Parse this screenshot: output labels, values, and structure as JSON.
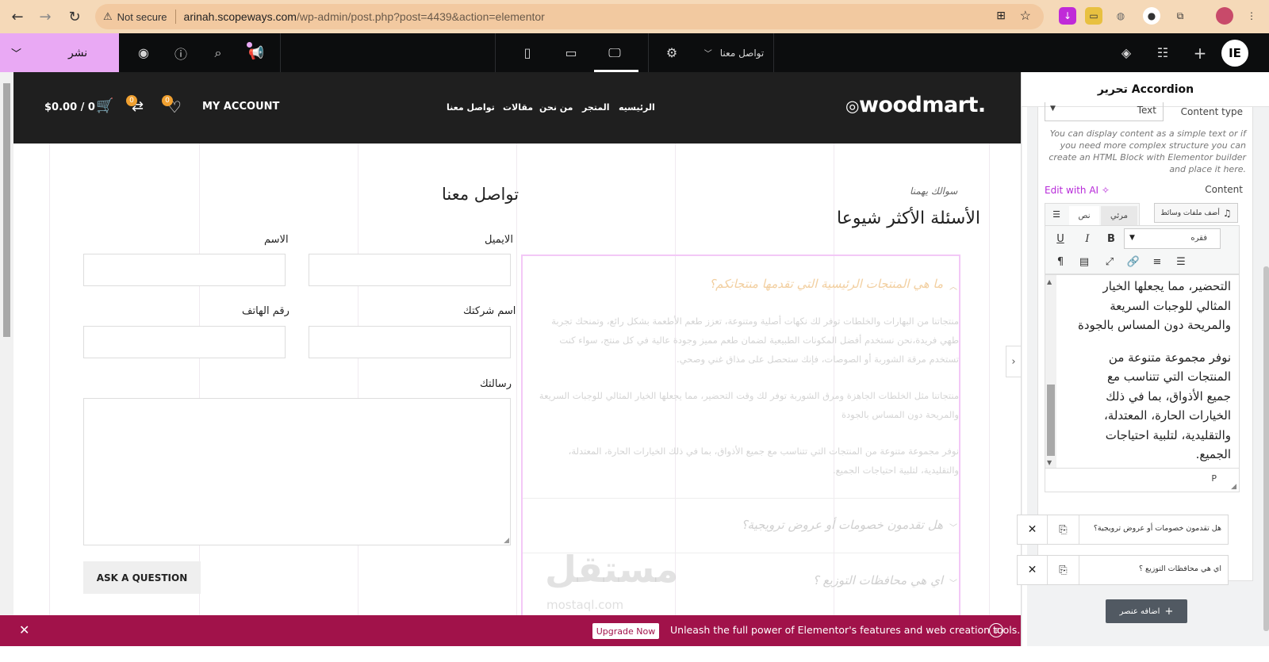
{
  "browser": {
    "not_secure": "Not secure",
    "url_host": "arinah.scopeways.com",
    "url_path": "/wp-admin/post.php?post=4439&action=elementor"
  },
  "topbar": {
    "publish_label": "نشر",
    "page_name": "تواصل معنا"
  },
  "site": {
    "logo": "woodmart.",
    "nav": [
      "الرئيسيه",
      "المتجر",
      "من نحن",
      "مقالات",
      "تواصل معنا"
    ],
    "account": "MY ACCOUNT",
    "wishlist_count": "0",
    "compare_count": "0",
    "cart": "$0.00 / 0"
  },
  "faq": {
    "kicker": "سوالك يهمنا",
    "title": "الأسئلة الأكثر شيوعا",
    "q1": "ما هي المنتجات الرئيسية التي تقدمها منتجاتكم؟",
    "p1": "منتجاتنا من البهارات والخلطات توفر لك نكهات أصلية ومتنوعة، تعزز طعم الأطعمة بشكل رائع، وتمنحك تجربة طهي فريدة،نحن نستخدم أفضل المكونات الطبيعية لضمان طعم مميز وجودة عالية في كل منتج، سواء كنت تستخدم مرقة الشوربة أو الصوصات، فإنك ستحصل على مذاق غني وصحي.",
    "p2": "منتجاتنا مثل الخلطات الجاهزة ومرق الشوربة توفر لك وقت التحضير، مما يجعلها الخيار المثالي للوجبات السريعة والمريحة دون المساس بالجودة",
    "p3": "نوفر مجموعة متنوعة من المنتجات التي تتناسب مع جميع الأذواق، بما في ذلك الخيارات الحارة، المعتدلة، والتقليدية، لتلبية احتياجات الجميع.",
    "q2": "هل تقدمون خصومات أو عروض ترويجية؟",
    "q3": "اي هي محافظات التوزيع ؟"
  },
  "contact": {
    "title": "تواصل معنا",
    "name_label": "الاسم",
    "email_label": "الايميل",
    "phone_label": "رقم الهاتف",
    "company_label": "اسم شركتك",
    "message_label": "رسالتك",
    "submit": "ASK A QUESTION"
  },
  "panel": {
    "title": "تحرير Accordion",
    "content_type_label": "Content type",
    "content_type_value": "Text",
    "help": "You can display content as a simple text or if you need more complex structure you can create an HTML Block with Elementor builder and place it here.",
    "edit_ai": "Edit with AI",
    "content_label": "Content",
    "add_media": "أضف ملفات وسائط",
    "tab_visual": "مرئي",
    "tab_text": "نص",
    "format_value": "فقره",
    "editor_lines": [
      "التحضير، مما يجعلها الخيار",
      "المثالي للوجبات السريعة",
      "والمريحة دون المساس بالجودة",
      "",
      "نوفر مجموعة متنوعة من",
      "المنتجات التي تتناسب مع",
      "جميع الأذواق، بما في ذلك",
      "الخيارات الحارة، المعتدلة،",
      "والتقليدية، لتلبية احتياجات",
      "الجميع."
    ],
    "status_path": "P",
    "item2": "هل تقدمون خصومات أو عروض ترويجية؟",
    "item3": "اي هي محافظات التوزيع ؟",
    "add_item": "اضافه عنصر"
  },
  "banner": {
    "text": "Unleash the full power of Elementor's features and web creation tools.",
    "button": "Upgrade Now"
  },
  "watermark": {
    "ar": "مستقل",
    "en": "mostaql.com"
  },
  "colors": {
    "accent": "#e9a9f4",
    "banner": "#a1124a",
    "badge": "#f0a030"
  }
}
